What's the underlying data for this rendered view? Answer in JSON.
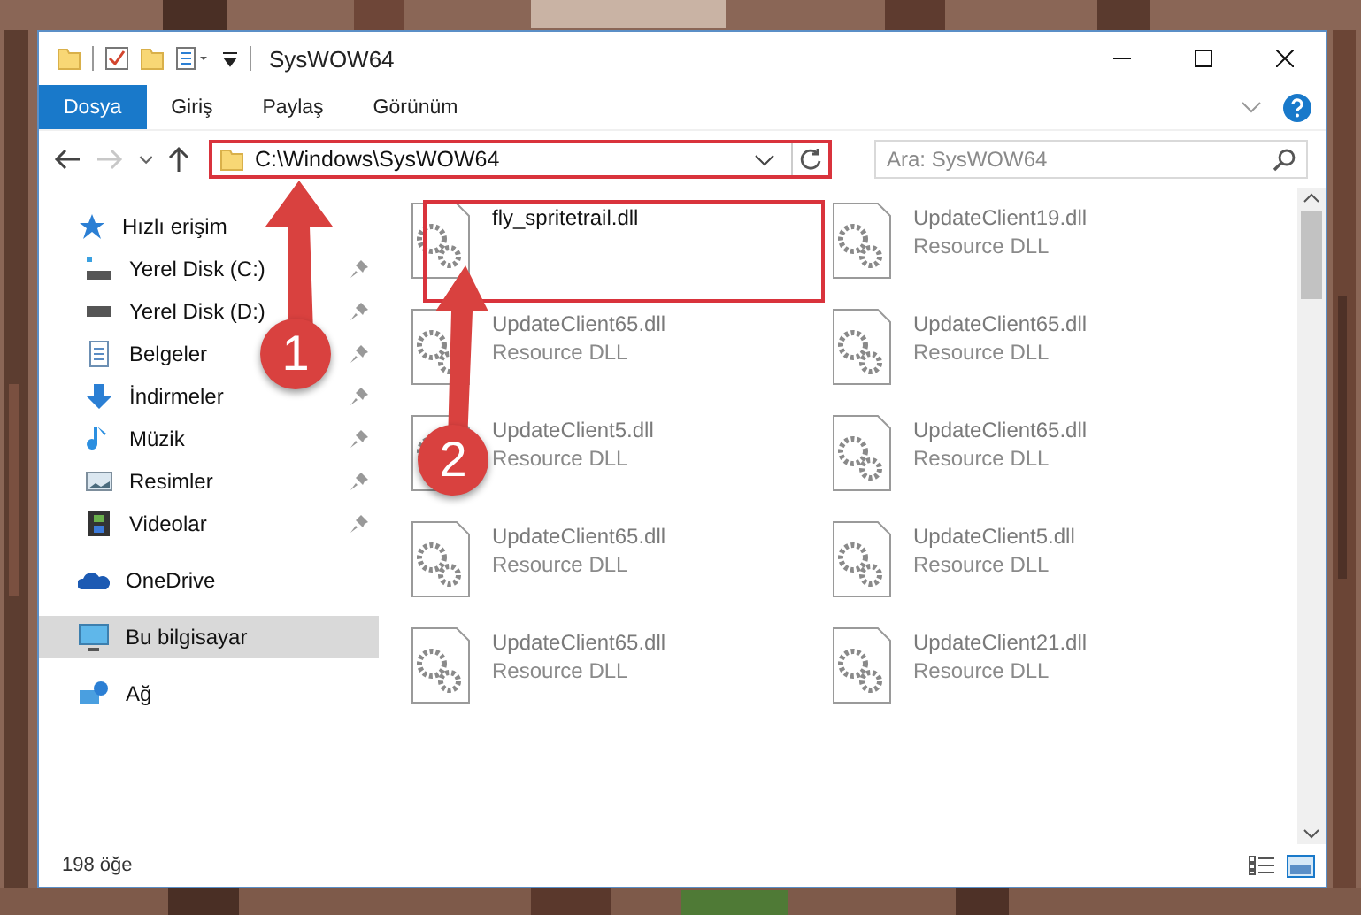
{
  "window": {
    "title": "SysWOW64"
  },
  "ribbon": {
    "tabs": [
      {
        "label": "Dosya",
        "kind": "file",
        "selected": false
      },
      {
        "label": "Giriş",
        "kind": "tab",
        "selected": false
      },
      {
        "label": "Paylaş",
        "kind": "tab",
        "selected": false
      },
      {
        "label": "Görünüm",
        "kind": "tab",
        "selected": false
      }
    ]
  },
  "navigation": {
    "forward_disabled": true
  },
  "address": {
    "path": "C:\\Windows\\SysWOW64",
    "highlighted": true
  },
  "search": {
    "placeholder": "Ara: SysWOW64"
  },
  "sidebar": {
    "items": [
      {
        "label": "Hızlı erişim",
        "kind": "quick",
        "selected": false,
        "children": [
          {
            "label": "Yerel Disk (C:)",
            "kind": "disk-c",
            "pinned": true,
            "selected": false
          },
          {
            "label": "Yerel Disk (D:)",
            "kind": "disk",
            "pinned": true,
            "selected": false
          },
          {
            "label": "Belgeler",
            "kind": "documents",
            "pinned": true,
            "selected": false
          },
          {
            "label": "İndirmeler",
            "kind": "downloads",
            "pinned": true,
            "selected": false
          },
          {
            "label": "Müzik",
            "kind": "music",
            "pinned": true,
            "selected": false
          },
          {
            "label": "Resimler",
            "kind": "pictures",
            "pinned": true,
            "selected": false
          },
          {
            "label": "Videolar",
            "kind": "videos",
            "pinned": true,
            "selected": false
          }
        ]
      },
      {
        "label": "OneDrive",
        "kind": "cloud",
        "selected": false
      },
      {
        "label": "Bu bilgisayar",
        "kind": "computer",
        "selected": true
      },
      {
        "label": "Ağ",
        "kind": "network",
        "selected": false
      }
    ]
  },
  "files": [
    {
      "name": "fly_spritetrail.dll",
      "blurred": false,
      "highlighted": true
    },
    {
      "name": "UpdateClient19.dll",
      "type": "Resource DLL",
      "blurred": true,
      "highlighted": false
    },
    {
      "name": "UpdateClient65.dll",
      "type": "Resource DLL",
      "blurred": true,
      "highlighted": false
    },
    {
      "name": "UpdateClient65.dll",
      "type": "Resource DLL",
      "blurred": true,
      "highlighted": false
    },
    {
      "name": "UpdateClient5.dll",
      "type": "Resource DLL",
      "blurred": true,
      "highlighted": false
    },
    {
      "name": "UpdateClient65.dll",
      "type": "Resource DLL",
      "blurred": true,
      "highlighted": false
    },
    {
      "name": "UpdateClient65.dll",
      "type": "Resource DLL",
      "blurred": true,
      "highlighted": false
    },
    {
      "name": "UpdateClient5.dll",
      "type": "Resource DLL",
      "blurred": true,
      "highlighted": false
    },
    {
      "name": "UpdateClient65.dll",
      "type": "Resource DLL",
      "blurred": true,
      "highlighted": false
    },
    {
      "name": "UpdateClient21.dll",
      "type": "Resource DLL",
      "blurred": true,
      "highlighted": false
    }
  ],
  "status_bar": {
    "count": "198 öğe"
  },
  "annotations": [
    {
      "number": "1"
    },
    {
      "number": "2"
    }
  ]
}
